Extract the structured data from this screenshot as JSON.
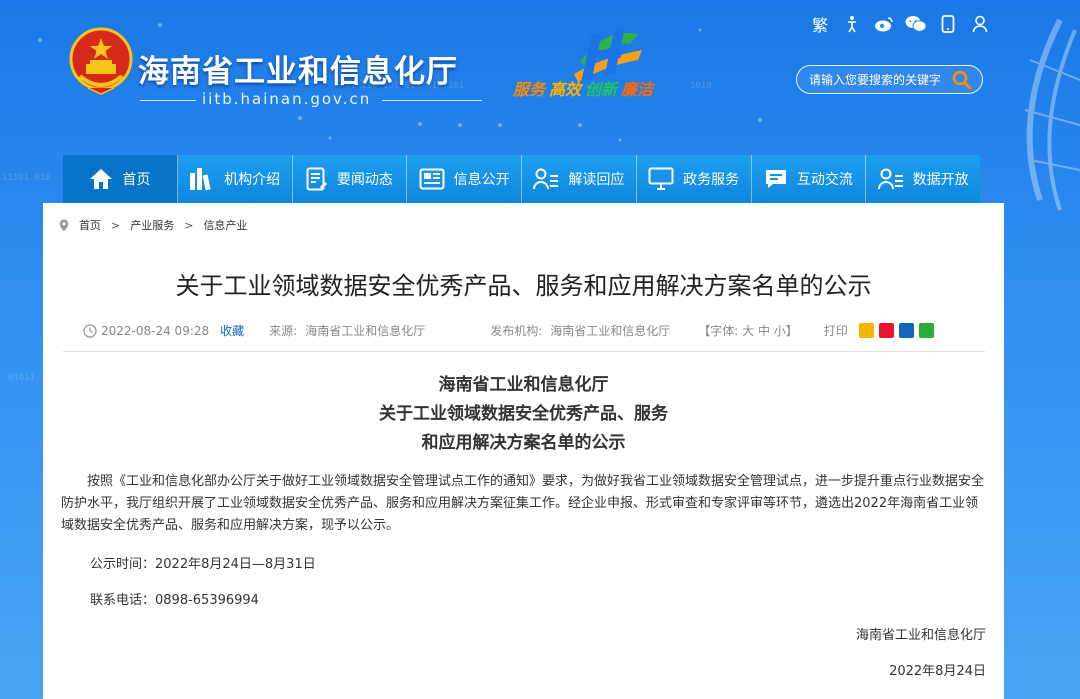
{
  "header": {
    "site_name": "海南省工业和信息化厅",
    "domain": "iitb.hainan.gov.cn",
    "slogan": [
      "服务",
      "高效",
      "创新",
      "廉洁"
    ],
    "search_placeholder": "请输入您要搜索的关键字",
    "tools": [
      {
        "icon": "traditional-chinese-icon",
        "text": "繁"
      },
      {
        "icon": "accessibility-icon",
        "text": ""
      },
      {
        "icon": "weibo-icon",
        "text": ""
      },
      {
        "icon": "wechat-icon",
        "text": ""
      },
      {
        "icon": "mobile-icon",
        "text": ""
      },
      {
        "icon": "user-icon",
        "text": ""
      }
    ]
  },
  "nav": {
    "items": [
      {
        "label": "首页",
        "icon": "home-icon"
      },
      {
        "label": "机构介绍",
        "icon": "books-icon"
      },
      {
        "label": "要闻动态",
        "icon": "news-icon"
      },
      {
        "label": "信息公开",
        "icon": "newspaper-icon"
      },
      {
        "label": "解读回应",
        "icon": "user-list-icon"
      },
      {
        "label": "政务服务",
        "icon": "monitor-icon"
      },
      {
        "label": "互动交流",
        "icon": "chat-icon"
      },
      {
        "label": "数据开放",
        "icon": "user-list-icon"
      }
    ]
  },
  "breadcrumb": [
    "首页",
    "产业服务",
    "信息产业"
  ],
  "article": {
    "title": "关于工业领域数据安全优秀产品、服务和应用解决方案名单的公示",
    "date": "2022-08-24 09:28",
    "favorite": "收藏",
    "source_label": "来源:",
    "source": "海南省工业和信息化厅",
    "publisher_label": "发布机构:",
    "publisher": "海南省工业和信息化厅",
    "font_size": "【字体: 大 中 小】",
    "print": "打印",
    "doc_title": [
      "海南省工业和信息化厅",
      "关于工业领域数据安全优秀产品、服务",
      "和应用解决方案名单的公示"
    ],
    "body": "按照《工业和信息化部办公厅关于做好工业领域数据安全管理试点工作的通知》要求，为做好我省工业领域数据安全管理试点，进一步提升重点行业数据安全防护水平，我厅组织开展了工业领域数据安全优秀产品、服务和应用解决方案征集工作。经企业申报、形式审查和专家评审等环节，遴选出2022年海南省工业领域数据安全优秀产品、服务和应用解决方案，现予以公示。",
    "period": "公示时间：2022年8月24日—8月31日",
    "phone": "联系电话：0898-65396994",
    "signature": "海南省工业和信息化厅",
    "sign_date": "2022年8月24日"
  },
  "colors": {
    "nav": "#1d9ff0",
    "nav_active": "#0874c8",
    "slogan_orange": "#ff8a00",
    "slogan_green": "#22c55e",
    "slogan_red": "#ef4444"
  }
}
